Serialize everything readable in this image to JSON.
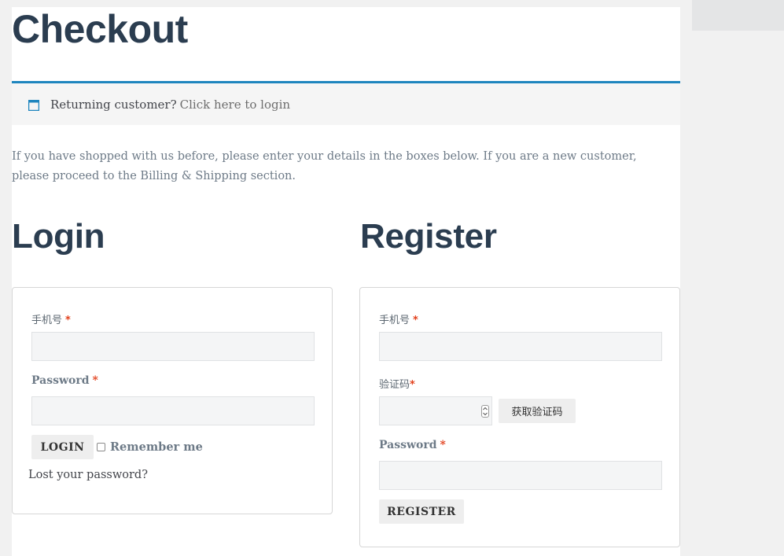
{
  "page": {
    "title": "Checkout"
  },
  "notice": {
    "icon": "window-icon",
    "text": "Returning customer?",
    "link": "Click here to login",
    "accent_color": "#1e85be"
  },
  "intro": {
    "text": "If you have shopped with us before, please enter your details in the boxes below. If you are a new customer, please proceed to the Billing & Shipping section."
  },
  "login": {
    "heading": "Login",
    "phone_label": "手机号",
    "phone_value": "",
    "password_label": "Password",
    "password_value": "",
    "required_mark": "*",
    "login_button": "LOGIN",
    "remember_label": "Remember me",
    "remember_checked": false,
    "lost_password": "Lost your password?"
  },
  "register": {
    "heading": "Register",
    "phone_label": "手机号",
    "phone_value": "",
    "code_label": "验证码",
    "code_value": "",
    "get_code_button": "获取验证码",
    "password_label": "Password",
    "password_value": "",
    "required_mark": "*",
    "register_button": "REGISTER"
  },
  "colors": {
    "heading": "#2b3d50",
    "required": "#e2401c",
    "muted_text": "#6d7a87"
  }
}
